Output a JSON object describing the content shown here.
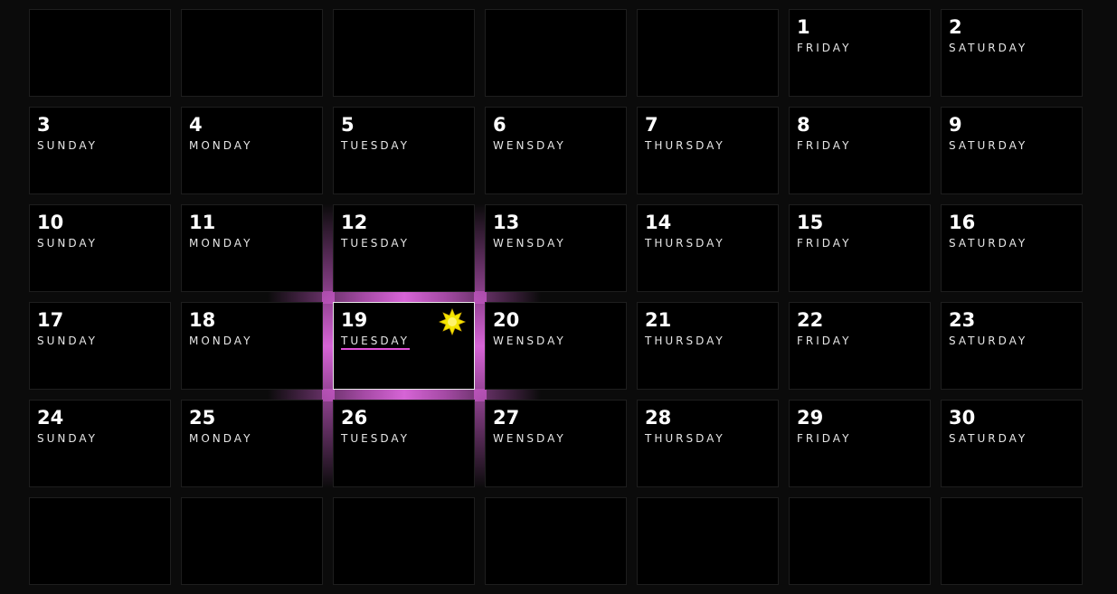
{
  "calendar": {
    "weeks": [
      [
        {
          "day": "",
          "weekday": ""
        },
        {
          "day": "",
          "weekday": ""
        },
        {
          "day": "",
          "weekday": ""
        },
        {
          "day": "",
          "weekday": ""
        },
        {
          "day": "",
          "weekday": ""
        },
        {
          "day": "1",
          "weekday": "FRIDAY"
        },
        {
          "day": "2",
          "weekday": "SATURDAY"
        }
      ],
      [
        {
          "day": "3",
          "weekday": "SUNDAY"
        },
        {
          "day": "4",
          "weekday": "MONDAY"
        },
        {
          "day": "5",
          "weekday": "TUESDAY"
        },
        {
          "day": "6",
          "weekday": "WENSDAY"
        },
        {
          "day": "7",
          "weekday": "THURSDAY"
        },
        {
          "day": "8",
          "weekday": "FRIDAY"
        },
        {
          "day": "9",
          "weekday": "SATURDAY"
        }
      ],
      [
        {
          "day": "10",
          "weekday": "SUNDAY"
        },
        {
          "day": "11",
          "weekday": "MONDAY"
        },
        {
          "day": "12",
          "weekday": "TUESDAY"
        },
        {
          "day": "13",
          "weekday": "WENSDAY"
        },
        {
          "day": "14",
          "weekday": "THURSDAY"
        },
        {
          "day": "15",
          "weekday": "FRIDAY"
        },
        {
          "day": "16",
          "weekday": "SATURDAY"
        }
      ],
      [
        {
          "day": "17",
          "weekday": "SUNDAY"
        },
        {
          "day": "18",
          "weekday": "MONDAY"
        },
        {
          "day": "19",
          "weekday": "TUESDAY",
          "today": true,
          "icon": "star-icon"
        },
        {
          "day": "20",
          "weekday": "WENSDAY"
        },
        {
          "day": "21",
          "weekday": "THURSDAY"
        },
        {
          "day": "22",
          "weekday": "FRIDAY"
        },
        {
          "day": "23",
          "weekday": "SATURDAY"
        }
      ],
      [
        {
          "day": "24",
          "weekday": "SUNDAY"
        },
        {
          "day": "25",
          "weekday": "MONDAY"
        },
        {
          "day": "26",
          "weekday": "TUESDAY"
        },
        {
          "day": "27",
          "weekday": "WENSDAY"
        },
        {
          "day": "28",
          "weekday": "THURSDAY"
        },
        {
          "day": "29",
          "weekday": "FRIDAY"
        },
        {
          "day": "30",
          "weekday": "SATURDAY"
        }
      ],
      [
        {
          "day": "",
          "weekday": ""
        },
        {
          "day": "",
          "weekday": ""
        },
        {
          "day": "",
          "weekday": ""
        },
        {
          "day": "",
          "weekday": ""
        },
        {
          "day": "",
          "weekday": ""
        },
        {
          "day": "",
          "weekday": ""
        },
        {
          "day": "",
          "weekday": ""
        }
      ]
    ]
  },
  "colors": {
    "background": "#0b0b0b",
    "cell": "#000000",
    "highlight": "#e04fd6",
    "star": "#f5e600"
  }
}
